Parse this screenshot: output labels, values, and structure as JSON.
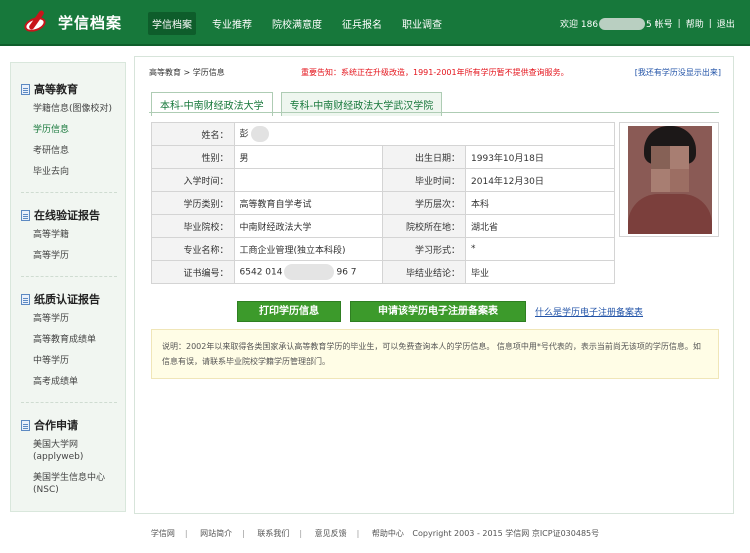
{
  "header": {
    "logo_text": "学信档案",
    "nav": [
      "学信档案",
      "专业推荐",
      "院校满意度",
      "征兵报名",
      "职业调查"
    ],
    "welcome_prefix": "欢迎 186",
    "account_suffix": "5 帐号",
    "help": "帮助",
    "logout": "退出"
  },
  "sidebar": {
    "sections": [
      {
        "title": "高等教育",
        "items": [
          "学籍信息(图像校对)",
          "学历信息",
          "考研信息",
          "毕业去向"
        ]
      },
      {
        "title": "在线验证报告",
        "items": [
          "高等学籍",
          "高等学历"
        ]
      },
      {
        "title": "纸质认证报告",
        "items": [
          "高等学历",
          "高等教育成绩单",
          "中等学历",
          "高考成绩单"
        ]
      },
      {
        "title": "合作申请",
        "items": [
          "美国大学网 (applyweb)",
          "美国学生信息中心 (NSC)"
        ]
      }
    ]
  },
  "main": {
    "breadcrumb": "高等教育 > 学历信息",
    "notice": "重要告知：系统正在升级改造，1991-2001年所有学历暂不提供查询服务。",
    "missing_link": "[我还有学历没显示出来]",
    "tabs": [
      "本科-中南财经政法大学",
      "专科-中南财经政法大学武汉学院"
    ],
    "fields": {
      "name_label": "姓名：",
      "name_value": "彭",
      "gender_label": "性别：",
      "gender_value": "男",
      "birth_label": "出生日期：",
      "birth_value": "1993年10月18日",
      "enroll_label": "入学时间：",
      "enroll_value": "",
      "grad_label": "毕业时间：",
      "grad_value": "2014年12月30日",
      "category_label": "学历类别：",
      "category_value": "高等教育自学考试",
      "level_label": "学历层次：",
      "level_value": "本科",
      "school_label": "毕业院校：",
      "school_value": "中南财经政法大学",
      "location_label": "院校所在地：",
      "location_value": "湖北省",
      "major_label": "专业名称：",
      "major_value": "工商企业管理(独立本科段)",
      "form_label": "学习形式：",
      "form_value": "*",
      "cert_label": "证书编号：",
      "cert_prefix": "6542 014",
      "cert_suffix": "96 7",
      "result_label": "毕结业结论：",
      "result_value": "毕业"
    },
    "buttons": {
      "print": "打印学历信息",
      "apply": "申请该学历电子注册备案表",
      "help_link": "什么是学历电子注册备案表"
    },
    "note": "说明：2002年以来取得各类国家承认高等教育学历的毕业生，可以免费查询本人的学历信息。 信息项中用*号代表的，表示当前尚无该项的学历信息。如信息有误，请联系毕业院校学籍学历管理部门。"
  },
  "footer": {
    "links": [
      "学信网",
      "网站简介",
      "联系我们",
      "意见反馈",
      "帮助中心"
    ],
    "copyright": "Copyright 2003 - 2015 学信网 京ICP证030485号"
  },
  "colors": {
    "header_green": "#17783b",
    "button_green": "#3c9a2b",
    "notice_red": "#e4141c",
    "link_blue": "#2354a8"
  }
}
